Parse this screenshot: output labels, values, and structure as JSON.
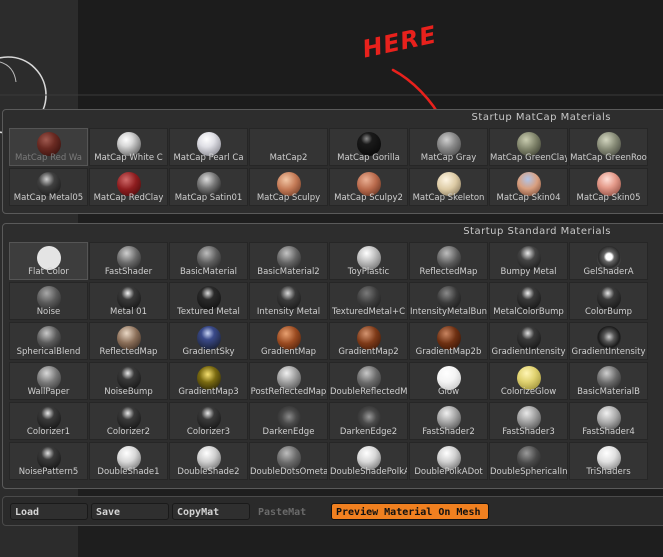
{
  "annotation": {
    "text": "HERE",
    "color": "#e8211c"
  },
  "matcap_panel": {
    "title": "Startup MatCap Materials",
    "items": [
      {
        "label": "MatCap Red Wa",
        "ball": "radial-gradient(circle at 38% 32%, #a05a50 0%, #6a2a22 40%, #2a0a08 100%)",
        "dim": true,
        "selected": true
      },
      {
        "label": "MatCap White C",
        "ball": "radial-gradient(circle at 38% 32%, #ffffff 0%, #d8d8d8 30%, #6a6a6a 80%, #2a2a2a 100%)"
      },
      {
        "label": "MatCap Pearl Ca",
        "ball": "radial-gradient(circle at 40% 30%, #ffffff 0%, #e0e0e6 35%, #8a8a92 85%, #4a4a50 100%)"
      },
      {
        "label": "MatCap2",
        "ball": "none"
      },
      {
        "label": "MatCap Gorilla",
        "ball": "radial-gradient(circle at 40% 28%, #8a8a8a 0%, #1a1a1a 25%, #050505 100%)"
      },
      {
        "label": "MatCap Gray",
        "ball": "radial-gradient(circle at 40% 32%, #cfcfcf 0%, #8a8a8a 40%, #3a3a3a 100%)"
      },
      {
        "label": "MatCap GreenClay",
        "ball": "radial-gradient(circle at 38% 32%, #c9ccb0 0%, #7f836a 45%, #2c2e24 100%)"
      },
      {
        "label": "MatCap GreenRoo",
        "ball": "radial-gradient(circle at 38% 32%, #d3d6c0 0%, #868a76 45%, #343630 100%)"
      },
      {
        "label": "MatCap Metal05",
        "ball": "radial-gradient(circle at 40% 30%, #d0d0d0 0%, #404040 35%, #101010 100%)"
      },
      {
        "label": "MatCap RedClay",
        "ball": "radial-gradient(circle at 38% 32%, #d06a6a 0%, #8e1d1f 45%, #3a0808 100%)"
      },
      {
        "label": "MatCap Satin01",
        "ball": "radial-gradient(circle at 40% 30%, #dcdcdc 0%, #777 40%, #2a2a2a 80%, #555 100%)"
      },
      {
        "label": "MatCap Sculpy",
        "ball": "radial-gradient(circle at 38% 32%, #f2c7a6 0%, #c47a56 45%, #5a2c1a 100%)"
      },
      {
        "label": "MatCap Sculpy2",
        "ball": "radial-gradient(circle at 38% 32%, #eab094 0%, #b96a4c 45%, #4e2416 100%)"
      },
      {
        "label": "MatCap Skeleton",
        "ball": "radial-gradient(circle at 38% 32%, #fff6e4 0%, #dccaa4 45%, #6e6048 100%)"
      },
      {
        "label": "MatCap Skin04",
        "ball": "radial-gradient(circle at 45% 30%, #b0c4e8 0%, #d9a080 45%, #6a3a28 100%)"
      },
      {
        "label": "MatCap Skin05",
        "ball": "radial-gradient(circle at 42% 30%, #ffe0d8 0%, #e49a8a 40%, #7a3a30 100%)"
      }
    ]
  },
  "standard_panel": {
    "title": "Startup Standard Materials",
    "items": [
      {
        "label": "Flat Color",
        "ball": "radial-gradient(circle, #e4e4e4 0%, #e4e4e4 100%)",
        "selected": true
      },
      {
        "label": "FastShader",
        "ball": "radial-gradient(circle at 40% 30%, #cfcfcf 0%, #6a6a6a 45%, #1a1a1a 100%)"
      },
      {
        "label": "BasicMaterial",
        "ball": "radial-gradient(circle at 40% 30%, #bdbdbd 0%, #5e5e5e 45%, #1a1a1a 100%)"
      },
      {
        "label": "BasicMaterial2",
        "ball": "radial-gradient(circle at 40% 30%, #c4c4c4 0%, #646464 45%, #1a1a1a 100%)"
      },
      {
        "label": "ToyPlastic",
        "ball": "radial-gradient(circle at 40% 30%, #ffffff 0%, #c8c8c8 35%, #5a5a5a 100%)"
      },
      {
        "label": "ReflectedMap",
        "ball": "radial-gradient(circle at 40% 30%, #bdbdbd 0%, #5a5a5a 50%, #1a1a1a 100%)"
      },
      {
        "label": "Bumpy Metal",
        "ball": "radial-gradient(circle at 45% 30%, #e8e8e8 0%, #444 35%, #101010 100%)"
      },
      {
        "label": "GelShaderA",
        "ball": "radial-gradient(circle at 50% 45%, #ffffff 0%, #ffffff 18%, #666 30%, #2a2a2a 60%, #999 100%)"
      },
      {
        "label": "Noise",
        "ball": "radial-gradient(circle at 40% 30%, #a8a8a8 0%, #5a5a5a 45%, #1e1e1e 100%)"
      },
      {
        "label": "Metal 01",
        "ball": "radial-gradient(circle at 45% 30%, #f4f4f4 0%, #3a3a3a 30%, #0c0c0c 100%)"
      },
      {
        "label": "Textured Metal",
        "ball": "radial-gradient(circle at 45% 30%, #dadada 0%, #2a2a2a 30%, #0c0c0c 100%)"
      },
      {
        "label": "Intensity Metal",
        "ball": "radial-gradient(circle at 45% 30%, #d8d8d8 0%, #3a3a3a 35%, #101010 100%)"
      },
      {
        "label": "TexturedMetal+C",
        "ball": "radial-gradient(circle at 40% 30%, #7a7a7a 0%, #3e3e3e 45%, #141414 100%)"
      },
      {
        "label": "IntensityMetalBun",
        "ball": "radial-gradient(circle at 40% 30%, #8a8a8a 0%, #3a3a3a 45%, #101010 100%)"
      },
      {
        "label": "MetalColorBump",
        "ball": "radial-gradient(circle at 45% 30%, #f0f0f0 0%, #3a3a3a 30%, #0c0c0c 100%)"
      },
      {
        "label": "ColorBump",
        "ball": "radial-gradient(circle at 45% 30%, #e6e6e6 0%, #3a3a3a 30%, #0c0c0c 100%)"
      },
      {
        "label": "SphericalBlend",
        "ball": "radial-gradient(circle at 40% 30%, #c8c8c8 0%, #5a5a5a 45%, #1a1a1a 100%)"
      },
      {
        "label": "ReflectedMap",
        "ball": "radial-gradient(circle at 40% 30%, #e9d7c4 0%, #8a6e58 45%, #2c2018 100%)"
      },
      {
        "label": "GradientSky",
        "ball": "radial-gradient(circle at 45% 30%, #c8d4f4 0%, #3a4a8a 30%, #101418 100%)"
      },
      {
        "label": "GradientMap",
        "ball": "radial-gradient(circle at 38% 32%, #e8a070 0%, #9a4a20 45%, #3a1808 100%)"
      },
      {
        "label": "GradientMap2",
        "ball": "radial-gradient(circle at 38% 32%, #d49470 0%, #7e3a18 45%, #2e1206 100%)"
      },
      {
        "label": "GradientMap2b",
        "ball": "radial-gradient(circle at 38% 32%, #c88460 0%, #6e3012 45%, #280e04 100%)"
      },
      {
        "label": "GradientIntensity",
        "ball": "radial-gradient(circle at 45% 30%, #e0e0e0 0%, #3a3a3a 30%, #0c0c0c 100%)"
      },
      {
        "label": "GradientIntensity",
        "ball": "radial-gradient(circle at 50% 45%, #cfcfcf 0%, #555 30%, #1a1a1a 60%, #777 100%)"
      },
      {
        "label": "WallPaper",
        "ball": "radial-gradient(circle at 40% 30%, #d8d8d8 0%, #777 45%, #2a2a2a 100%)"
      },
      {
        "label": "NoiseBump",
        "ball": "radial-gradient(circle at 45% 30%, #e8e8e8 0%, #3a3a3a 30%, #0c0c0c 100%)"
      },
      {
        "label": "GradientMap3",
        "ball": "radial-gradient(circle at 45% 35%, #f6e070 0%, #7a6a10 40%, #141208 100%)"
      },
      {
        "label": "PostReflectedMap",
        "ball": "radial-gradient(circle at 40% 30%, #f0f0f0 0%, #9a9a9a 45%, #3a3a3a 100%)"
      },
      {
        "label": "DoubleReflectedM",
        "ball": "radial-gradient(circle at 40% 30%, #c8c8c8 0%, #6a6a6a 45%, #2a2a2a 100%)"
      },
      {
        "label": "Glow",
        "ball": "radial-gradient(circle at 40% 30%, #ffffff 0%, #f4f4f4 40%, #b8b8b8 100%)"
      },
      {
        "label": "ColorizeGlow",
        "ball": "radial-gradient(circle at 40% 30%, #fff5b4 0%, #e0d270 40%, #8a7e2a 100%)"
      },
      {
        "label": "BasicMaterialB",
        "ball": "radial-gradient(circle at 40% 30%, #cfcfcf 0%, #6a6a6a 45%, #1a1a1a 100%)"
      },
      {
        "label": "Colorizer1",
        "ball": "radial-gradient(circle at 45% 30%, #e8e8e8 0%, #3a3a3a 30%, #0c0c0c 100%)"
      },
      {
        "label": "Colorizer2",
        "ball": "radial-gradient(circle at 45% 30%, #e8e8e8 0%, #3a3a3a 30%, #0c0c0c 100%)"
      },
      {
        "label": "Colorizer3",
        "ball": "radial-gradient(circle at 45% 30%, #e8e8e8 0%, #3a3a3a 30%, #0c0c0c 100%)"
      },
      {
        "label": "DarkenEdge",
        "ball": "radial-gradient(circle at 50% 45%, #8a8a8a 0%, #4a4a4a 40%, #1a1a1a 100%)"
      },
      {
        "label": "DarkenEdge2",
        "ball": "radial-gradient(circle at 50% 45%, #9a9a9a 0%, #4a4a4a 40%, #1a1a1a 100%)"
      },
      {
        "label": "FastShader2",
        "ball": "radial-gradient(circle at 40% 30%, #f0f0f0 0%, #a0a0a0 45%, #3a3a3a 100%)"
      },
      {
        "label": "FastShader3",
        "ball": "radial-gradient(circle at 40% 30%, #e8e8e8 0%, #9a9a9a 45%, #3a3a3a 100%)"
      },
      {
        "label": "FastShader4",
        "ball": "radial-gradient(circle at 40% 30%, #f0f0f0 0%, #a8a8a8 45%, #3a3a3a 100%)"
      },
      {
        "label": "NoisePattern5",
        "ball": "radial-gradient(circle at 45% 30%, #e0e0e0 0%, #3a3a3a 30%, #0c0c0c 100%)"
      },
      {
        "label": "DoubleShade1",
        "ball": "radial-gradient(circle at 40% 30%, #ffffff 0%, #d8d8d8 40%, #5a5a5a 100%)"
      },
      {
        "label": "DoubleShade2",
        "ball": "radial-gradient(circle at 40% 30%, #ffffff 0%, #cfcfcf 40%, #555 100%)"
      },
      {
        "label": "DoubleDotsOmeta",
        "ball": "radial-gradient(circle at 40% 30%, #bdbdbd 0%, #6a6a6a 45%, #2a2a2a 100%)"
      },
      {
        "label": "DoubleShadePolkA",
        "ball": "radial-gradient(circle at 40% 30%, #ffffff 0%, #d8d8d8 40%, #5a5a5a 100%)"
      },
      {
        "label": "DoublePolkADot",
        "ball": "radial-gradient(circle at 40% 30%, #ffffff 0%, #d0d0d0 40%, #555 100%)"
      },
      {
        "label": "DoubleSphericalInt",
        "ball": "radial-gradient(circle at 40% 30%, #9a9a9a 0%, #4a4a4a 45%, #1a1a1a 100%)"
      },
      {
        "label": "TriShaders",
        "ball": "radial-gradient(circle at 40% 30%, #ffffff 0%, #e0e0e0 40%, #6a6a6a 100%)"
      }
    ]
  },
  "bottom_bar": {
    "load": "Load",
    "save": "Save",
    "copymat": "CopyMat",
    "pastemat": "PasteMat",
    "preview": "Preview Material On Mesh"
  }
}
